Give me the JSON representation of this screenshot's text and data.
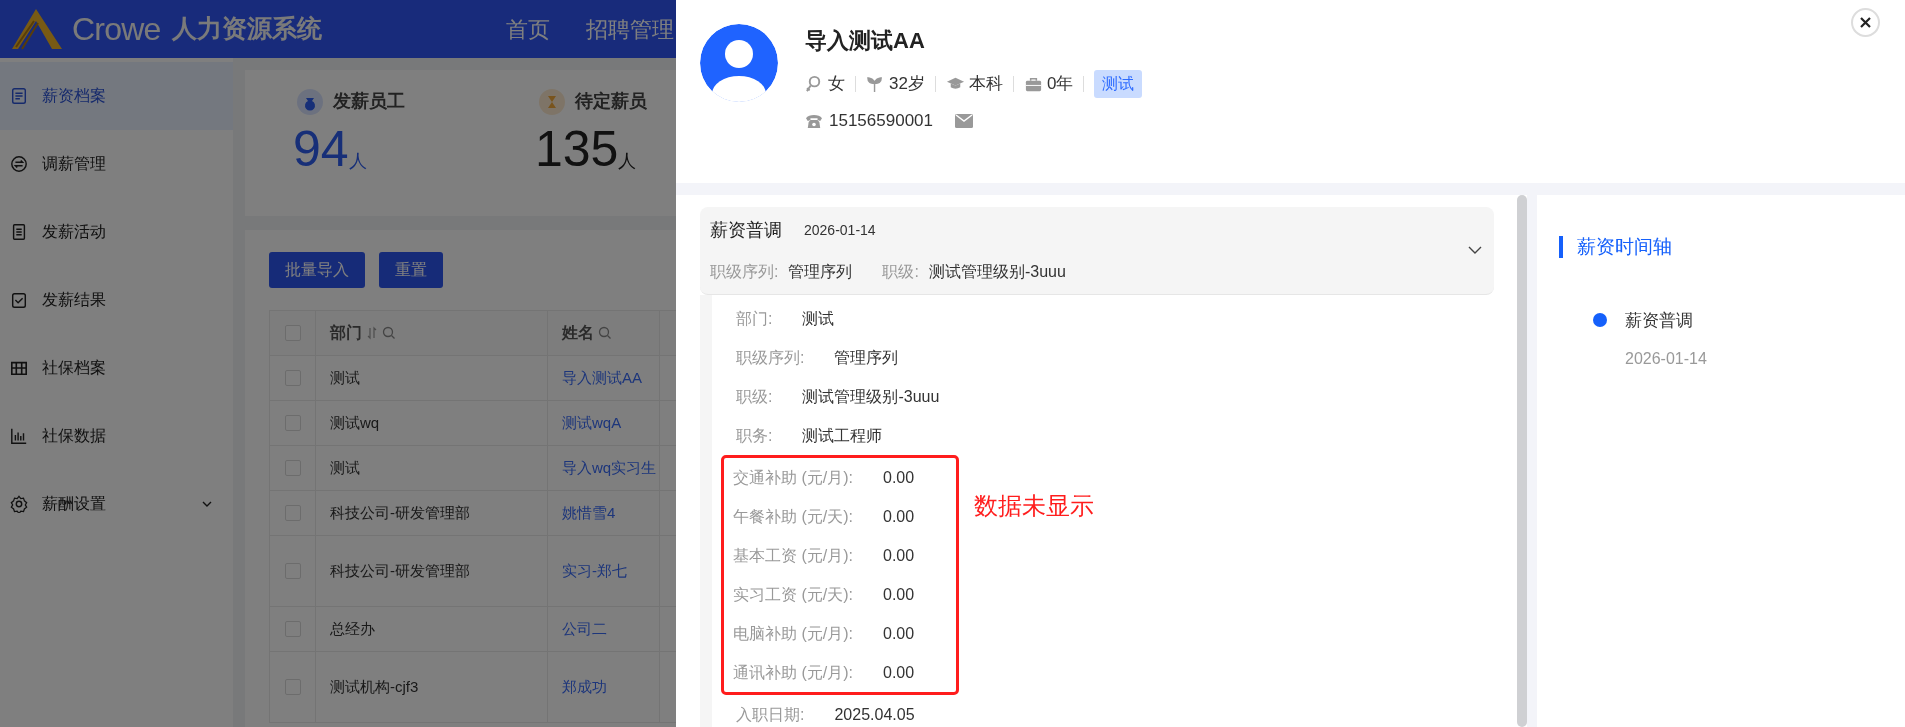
{
  "header": {
    "brand": "Crowe",
    "system_name": "人力资源系统",
    "nav": [
      "首页",
      "招聘管理"
    ]
  },
  "sidebar": {
    "items": [
      {
        "label": "薪资档案",
        "kind": "file",
        "selected": true
      },
      {
        "label": "调薪管理",
        "kind": "swap",
        "selected": false
      },
      {
        "label": "发薪活动",
        "kind": "list",
        "selected": false
      },
      {
        "label": "发薪结果",
        "kind": "check",
        "selected": false
      },
      {
        "label": "社保档案",
        "kind": "grid",
        "selected": false
      },
      {
        "label": "社保数据",
        "kind": "chart",
        "selected": false
      },
      {
        "label": "薪酬设置",
        "kind": "gear",
        "selected": false,
        "expanded": false
      }
    ]
  },
  "stats": [
    {
      "label": "发薪员工",
      "value": "94",
      "unit": "人",
      "kind": "bag"
    },
    {
      "label": "待定薪员",
      "value": "135",
      "unit": "人",
      "kind": "hourglass"
    }
  ],
  "toolbar": {
    "buttons": [
      "批量导入",
      "重置"
    ]
  },
  "table": {
    "all_checked": false,
    "columns": [
      "部门",
      "姓名"
    ],
    "rows": [
      {
        "department": "测试",
        "name": "导入测试AA",
        "checked": false
      },
      {
        "department": "测试wq",
        "name": "测试wqA",
        "checked": false
      },
      {
        "department": "测试",
        "name": "导入wq实习生",
        "checked": false
      },
      {
        "department": "科技公司-研发管理部",
        "name": "姚惜雪4",
        "checked": false
      },
      {
        "department": "科技公司-研发管理部",
        "name": "实习-郑七",
        "checked": false
      },
      {
        "department": "总经办",
        "name": "公司二",
        "checked": false
      },
      {
        "department": "测试机构-cjf3",
        "name": "郑成功",
        "checked": false
      }
    ]
  },
  "drawer": {
    "profile": {
      "name": "导入测试AA",
      "meta": [
        {
          "kind": "gender",
          "text": "女"
        },
        {
          "kind": "age",
          "text": "32岁"
        },
        {
          "kind": "education",
          "text": "本科"
        },
        {
          "kind": "experience",
          "text": "0年"
        }
      ],
      "tag": "测试",
      "phone": "15156590001"
    },
    "record": {
      "title": "薪资普调",
      "date": "2026-01-14",
      "expanded": true,
      "summary": [
        {
          "label": "职级序列:",
          "value": "管理序列"
        },
        {
          "label": "职级:",
          "value": "测试管理级别-3uuu"
        }
      ],
      "fields": [
        {
          "label": "部门:",
          "value": "测试",
          "boxed": false
        },
        {
          "label": "职级序列:",
          "value": "管理序列",
          "boxed": false
        },
        {
          "label": "职级:",
          "value": "测试管理级别-3uuu",
          "boxed": false
        },
        {
          "label": "职务:",
          "value": "测试工程师",
          "boxed": false
        },
        {
          "label": "交通补助 (元/月):",
          "value": "0.00",
          "boxed": true
        },
        {
          "label": "午餐补助 (元/天):",
          "value": "0.00",
          "boxed": true
        },
        {
          "label": "基本工资 (元/月):",
          "value": "0.00",
          "boxed": true
        },
        {
          "label": "实习工资 (元/天):",
          "value": "0.00",
          "boxed": true
        },
        {
          "label": "电脑补助 (元/月):",
          "value": "0.00",
          "boxed": true
        },
        {
          "label": "通讯补助 (元/月):",
          "value": "0.00",
          "boxed": true
        },
        {
          "label": "入职日期:",
          "value": "2025.04.05",
          "boxed": false
        }
      ],
      "annotation": "数据未显示"
    },
    "timeline": {
      "title": "薪资时间轴",
      "events": [
        {
          "title": "薪资普调",
          "date": "2026-01-14",
          "color": "#1560fb"
        }
      ]
    }
  }
}
